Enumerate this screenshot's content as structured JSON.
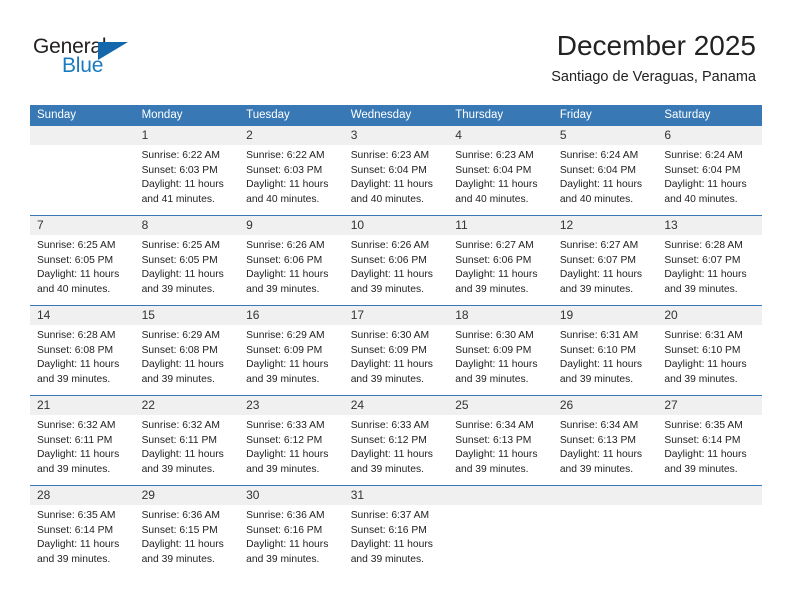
{
  "logo": {
    "word_general": "General",
    "word_blue": "Blue",
    "triangle_color": "#1567ac",
    "blue_color": "#1b7bc0"
  },
  "header": {
    "month_title": "December 2025",
    "location": "Santiago de Veraguas, Panama"
  },
  "theme": {
    "header_blue": "#3878b4",
    "daynum_bg": "#f0f0f0",
    "text": "#222222"
  },
  "calendar": {
    "weekday_headers": [
      "Sunday",
      "Monday",
      "Tuesday",
      "Wednesday",
      "Thursday",
      "Friday",
      "Saturday"
    ],
    "weeks": [
      [
        {
          "day": "",
          "l1": "",
          "l2": "",
          "l3": "",
          "l4": ""
        },
        {
          "day": "1",
          "l1": "Sunrise: 6:22 AM",
          "l2": "Sunset: 6:03 PM",
          "l3": "Daylight: 11 hours",
          "l4": "and 41 minutes."
        },
        {
          "day": "2",
          "l1": "Sunrise: 6:22 AM",
          "l2": "Sunset: 6:03 PM",
          "l3": "Daylight: 11 hours",
          "l4": "and 40 minutes."
        },
        {
          "day": "3",
          "l1": "Sunrise: 6:23 AM",
          "l2": "Sunset: 6:04 PM",
          "l3": "Daylight: 11 hours",
          "l4": "and 40 minutes."
        },
        {
          "day": "4",
          "l1": "Sunrise: 6:23 AM",
          "l2": "Sunset: 6:04 PM",
          "l3": "Daylight: 11 hours",
          "l4": "and 40 minutes."
        },
        {
          "day": "5",
          "l1": "Sunrise: 6:24 AM",
          "l2": "Sunset: 6:04 PM",
          "l3": "Daylight: 11 hours",
          "l4": "and 40 minutes."
        },
        {
          "day": "6",
          "l1": "Sunrise: 6:24 AM",
          "l2": "Sunset: 6:04 PM",
          "l3": "Daylight: 11 hours",
          "l4": "and 40 minutes."
        }
      ],
      [
        {
          "day": "7",
          "l1": "Sunrise: 6:25 AM",
          "l2": "Sunset: 6:05 PM",
          "l3": "Daylight: 11 hours",
          "l4": "and 40 minutes."
        },
        {
          "day": "8",
          "l1": "Sunrise: 6:25 AM",
          "l2": "Sunset: 6:05 PM",
          "l3": "Daylight: 11 hours",
          "l4": "and 39 minutes."
        },
        {
          "day": "9",
          "l1": "Sunrise: 6:26 AM",
          "l2": "Sunset: 6:06 PM",
          "l3": "Daylight: 11 hours",
          "l4": "and 39 minutes."
        },
        {
          "day": "10",
          "l1": "Sunrise: 6:26 AM",
          "l2": "Sunset: 6:06 PM",
          "l3": "Daylight: 11 hours",
          "l4": "and 39 minutes."
        },
        {
          "day": "11",
          "l1": "Sunrise: 6:27 AM",
          "l2": "Sunset: 6:06 PM",
          "l3": "Daylight: 11 hours",
          "l4": "and 39 minutes."
        },
        {
          "day": "12",
          "l1": "Sunrise: 6:27 AM",
          "l2": "Sunset: 6:07 PM",
          "l3": "Daylight: 11 hours",
          "l4": "and 39 minutes."
        },
        {
          "day": "13",
          "l1": "Sunrise: 6:28 AM",
          "l2": "Sunset: 6:07 PM",
          "l3": "Daylight: 11 hours",
          "l4": "and 39 minutes."
        }
      ],
      [
        {
          "day": "14",
          "l1": "Sunrise: 6:28 AM",
          "l2": "Sunset: 6:08 PM",
          "l3": "Daylight: 11 hours",
          "l4": "and 39 minutes."
        },
        {
          "day": "15",
          "l1": "Sunrise: 6:29 AM",
          "l2": "Sunset: 6:08 PM",
          "l3": "Daylight: 11 hours",
          "l4": "and 39 minutes."
        },
        {
          "day": "16",
          "l1": "Sunrise: 6:29 AM",
          "l2": "Sunset: 6:09 PM",
          "l3": "Daylight: 11 hours",
          "l4": "and 39 minutes."
        },
        {
          "day": "17",
          "l1": "Sunrise: 6:30 AM",
          "l2": "Sunset: 6:09 PM",
          "l3": "Daylight: 11 hours",
          "l4": "and 39 minutes."
        },
        {
          "day": "18",
          "l1": "Sunrise: 6:30 AM",
          "l2": "Sunset: 6:09 PM",
          "l3": "Daylight: 11 hours",
          "l4": "and 39 minutes."
        },
        {
          "day": "19",
          "l1": "Sunrise: 6:31 AM",
          "l2": "Sunset: 6:10 PM",
          "l3": "Daylight: 11 hours",
          "l4": "and 39 minutes."
        },
        {
          "day": "20",
          "l1": "Sunrise: 6:31 AM",
          "l2": "Sunset: 6:10 PM",
          "l3": "Daylight: 11 hours",
          "l4": "and 39 minutes."
        }
      ],
      [
        {
          "day": "21",
          "l1": "Sunrise: 6:32 AM",
          "l2": "Sunset: 6:11 PM",
          "l3": "Daylight: 11 hours",
          "l4": "and 39 minutes."
        },
        {
          "day": "22",
          "l1": "Sunrise: 6:32 AM",
          "l2": "Sunset: 6:11 PM",
          "l3": "Daylight: 11 hours",
          "l4": "and 39 minutes."
        },
        {
          "day": "23",
          "l1": "Sunrise: 6:33 AM",
          "l2": "Sunset: 6:12 PM",
          "l3": "Daylight: 11 hours",
          "l4": "and 39 minutes."
        },
        {
          "day": "24",
          "l1": "Sunrise: 6:33 AM",
          "l2": "Sunset: 6:12 PM",
          "l3": "Daylight: 11 hours",
          "l4": "and 39 minutes."
        },
        {
          "day": "25",
          "l1": "Sunrise: 6:34 AM",
          "l2": "Sunset: 6:13 PM",
          "l3": "Daylight: 11 hours",
          "l4": "and 39 minutes."
        },
        {
          "day": "26",
          "l1": "Sunrise: 6:34 AM",
          "l2": "Sunset: 6:13 PM",
          "l3": "Daylight: 11 hours",
          "l4": "and 39 minutes."
        },
        {
          "day": "27",
          "l1": "Sunrise: 6:35 AM",
          "l2": "Sunset: 6:14 PM",
          "l3": "Daylight: 11 hours",
          "l4": "and 39 minutes."
        }
      ],
      [
        {
          "day": "28",
          "l1": "Sunrise: 6:35 AM",
          "l2": "Sunset: 6:14 PM",
          "l3": "Daylight: 11 hours",
          "l4": "and 39 minutes."
        },
        {
          "day": "29",
          "l1": "Sunrise: 6:36 AM",
          "l2": "Sunset: 6:15 PM",
          "l3": "Daylight: 11 hours",
          "l4": "and 39 minutes."
        },
        {
          "day": "30",
          "l1": "Sunrise: 6:36 AM",
          "l2": "Sunset: 6:16 PM",
          "l3": "Daylight: 11 hours",
          "l4": "and 39 minutes."
        },
        {
          "day": "31",
          "l1": "Sunrise: 6:37 AM",
          "l2": "Sunset: 6:16 PM",
          "l3": "Daylight: 11 hours",
          "l4": "and 39 minutes."
        },
        {
          "day": "",
          "l1": "",
          "l2": "",
          "l3": "",
          "l4": ""
        },
        {
          "day": "",
          "l1": "",
          "l2": "",
          "l3": "",
          "l4": ""
        },
        {
          "day": "",
          "l1": "",
          "l2": "",
          "l3": "",
          "l4": ""
        }
      ]
    ]
  }
}
